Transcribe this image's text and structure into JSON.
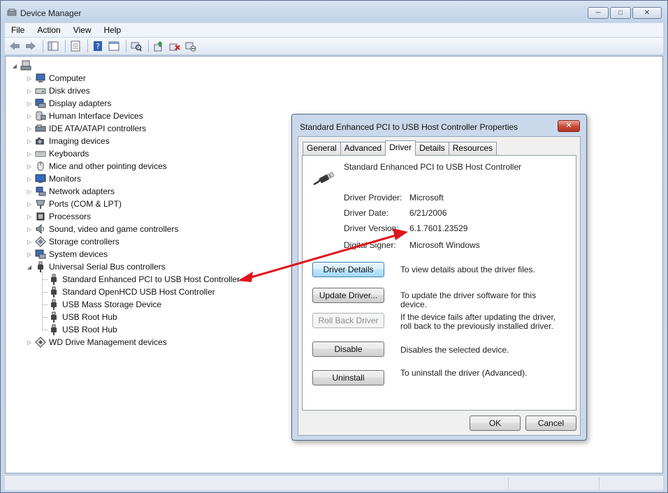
{
  "window": {
    "title": "Device Manager",
    "controls": {
      "minimize": "─",
      "maximize": "□",
      "close": "✕"
    }
  },
  "menu": [
    "File",
    "Action",
    "View",
    "Help"
  ],
  "toolbar": {
    "icons": [
      "back-icon",
      "forward-icon",
      "show-hide-tree-icon",
      "properties-icon",
      "help-icon",
      "view-icon",
      "scan-hardware-icon",
      "update-driver-icon",
      "uninstall-icon",
      "disable-icon"
    ]
  },
  "tree": {
    "categories": [
      {
        "label": "Computer",
        "icon": "computer-icon"
      },
      {
        "label": "Disk drives",
        "icon": "disk-drive-icon"
      },
      {
        "label": "Display adapters",
        "icon": "display-adapter-icon"
      },
      {
        "label": "Human Interface Devices",
        "icon": "hid-icon"
      },
      {
        "label": "IDE ATA/ATAPI controllers",
        "icon": "ide-controller-icon"
      },
      {
        "label": "Imaging devices",
        "icon": "camera-icon"
      },
      {
        "label": "Keyboards",
        "icon": "keyboard-icon"
      },
      {
        "label": "Mice and other pointing devices",
        "icon": "mouse-icon"
      },
      {
        "label": "Monitors",
        "icon": "monitor-icon"
      },
      {
        "label": "Network adapters",
        "icon": "network-adapter-icon"
      },
      {
        "label": "Ports (COM & LPT)",
        "icon": "port-icon"
      },
      {
        "label": "Processors",
        "icon": "processor-icon"
      },
      {
        "label": "Sound, video and game controllers",
        "icon": "sound-icon"
      },
      {
        "label": "Storage controllers",
        "icon": "storage-controller-icon"
      },
      {
        "label": "System devices",
        "icon": "system-device-icon"
      },
      {
        "label": "Universal Serial Bus controllers",
        "icon": "usb-icon",
        "expanded": true
      },
      {
        "label": "WD Drive Management devices",
        "icon": "wd-icon"
      }
    ],
    "usb_children": [
      "Standard Enhanced PCI to USB Host Controller",
      "Standard OpenHCD USB Host Controller",
      "USB Mass Storage Device",
      "USB Root Hub",
      "USB Root Hub"
    ]
  },
  "dialog": {
    "title": "Standard Enhanced PCI to USB Host Controller Properties",
    "close": "✕",
    "tabs": [
      "General",
      "Advanced",
      "Driver",
      "Details",
      "Resources"
    ],
    "active_tab": "Driver",
    "device_name": "Standard Enhanced PCI to USB Host Controller",
    "fields": [
      {
        "label": "Driver Provider:",
        "value": "Microsoft"
      },
      {
        "label": "Driver Date:",
        "value": "6/21/2006"
      },
      {
        "label": "Driver Version:",
        "value": "6.1.7601.23529"
      },
      {
        "label": "Digital Signer:",
        "value": "Microsoft Windows"
      }
    ],
    "actions": [
      {
        "label": "Driver Details",
        "desc": "To view details about the driver files.",
        "state": "focused"
      },
      {
        "label": "Update Driver...",
        "desc": "To update the driver software for this device.",
        "state": "normal"
      },
      {
        "label": "Roll Back Driver",
        "desc": "If the device fails after updating the driver, roll back to the previously installed driver.",
        "state": "disabled"
      },
      {
        "label": "Disable",
        "desc": "Disables the selected device.",
        "state": "normal"
      },
      {
        "label": "Uninstall",
        "desc": "To uninstall the driver (Advanced).",
        "state": "normal"
      }
    ],
    "ok": "OK",
    "cancel": "Cancel"
  },
  "colors": {
    "annotation_arrow": "#e0141a"
  }
}
